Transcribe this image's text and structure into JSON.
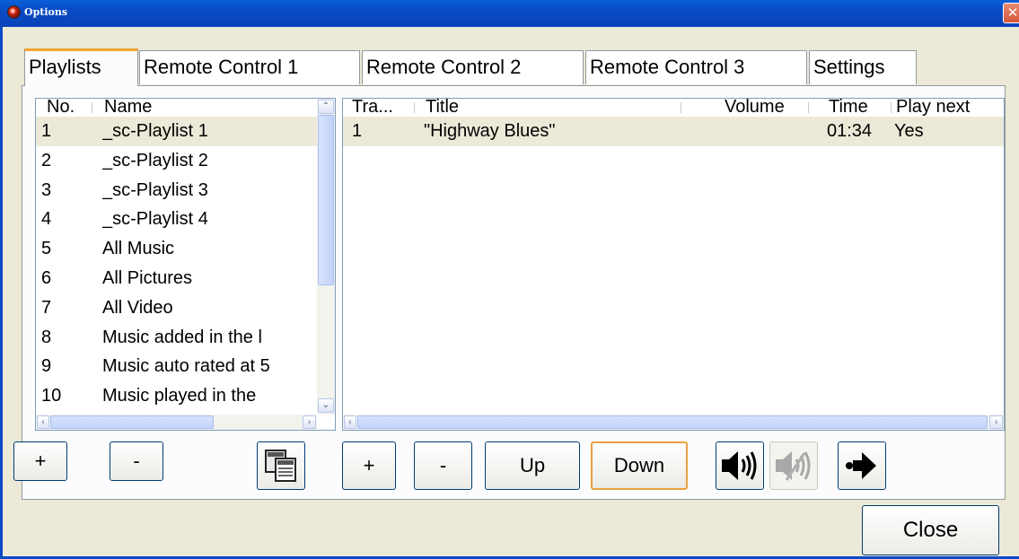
{
  "window": {
    "title": "Options",
    "close_glyph": "✕",
    "icon": "app-icon"
  },
  "tabs": [
    {
      "label": "Playlists",
      "active": true
    },
    {
      "label": "Remote Control 1",
      "active": false
    },
    {
      "label": "Remote Control 2",
      "active": false
    },
    {
      "label": "Remote Control 3",
      "active": false
    },
    {
      "label": "Settings",
      "active": false
    }
  ],
  "playlists": {
    "columns": [
      "No.",
      "Name"
    ],
    "rows": [
      {
        "no": "1",
        "name": "_sc-Playlist 1"
      },
      {
        "no": "2",
        "name": "_sc-Playlist 2"
      },
      {
        "no": "3",
        "name": "_sc-Playlist 3"
      },
      {
        "no": "4",
        "name": "_sc-Playlist 4"
      },
      {
        "no": "5",
        "name": "All Music"
      },
      {
        "no": "6",
        "name": "All Pictures"
      },
      {
        "no": "7",
        "name": "All Video"
      },
      {
        "no": "8",
        "name": "Music added in the l"
      },
      {
        "no": "9",
        "name": "Music auto rated at 5"
      },
      {
        "no": "10",
        "name": "Music played in the"
      }
    ],
    "selected_index": 0,
    "buttons": {
      "add": "+",
      "remove": "-"
    },
    "copy_icon": "copy-icon"
  },
  "tracks": {
    "columns": [
      "Tra...",
      "Title",
      "Volume",
      "Time",
      "Play next"
    ],
    "rows": [
      {
        "track": "1",
        "title": "\"Highway Blues\"",
        "volume": "",
        "time": "01:34",
        "play_next": "Yes"
      }
    ],
    "buttons": {
      "add": "+",
      "remove": "-",
      "up": "Up",
      "down": "Down"
    },
    "icons": [
      "speaker-on-icon",
      "speaker-muted-icon",
      "play-next-icon"
    ]
  },
  "scroll_arrows": {
    "up": "⌃",
    "down": "⌄",
    "left": "‹",
    "right": "›"
  },
  "close_button": "Close",
  "colors": {
    "titlebar": "#0a4ac6",
    "active_tab_accent": "#f4a531",
    "selection": "#ece9d8",
    "focus_border": "#e8a040"
  }
}
